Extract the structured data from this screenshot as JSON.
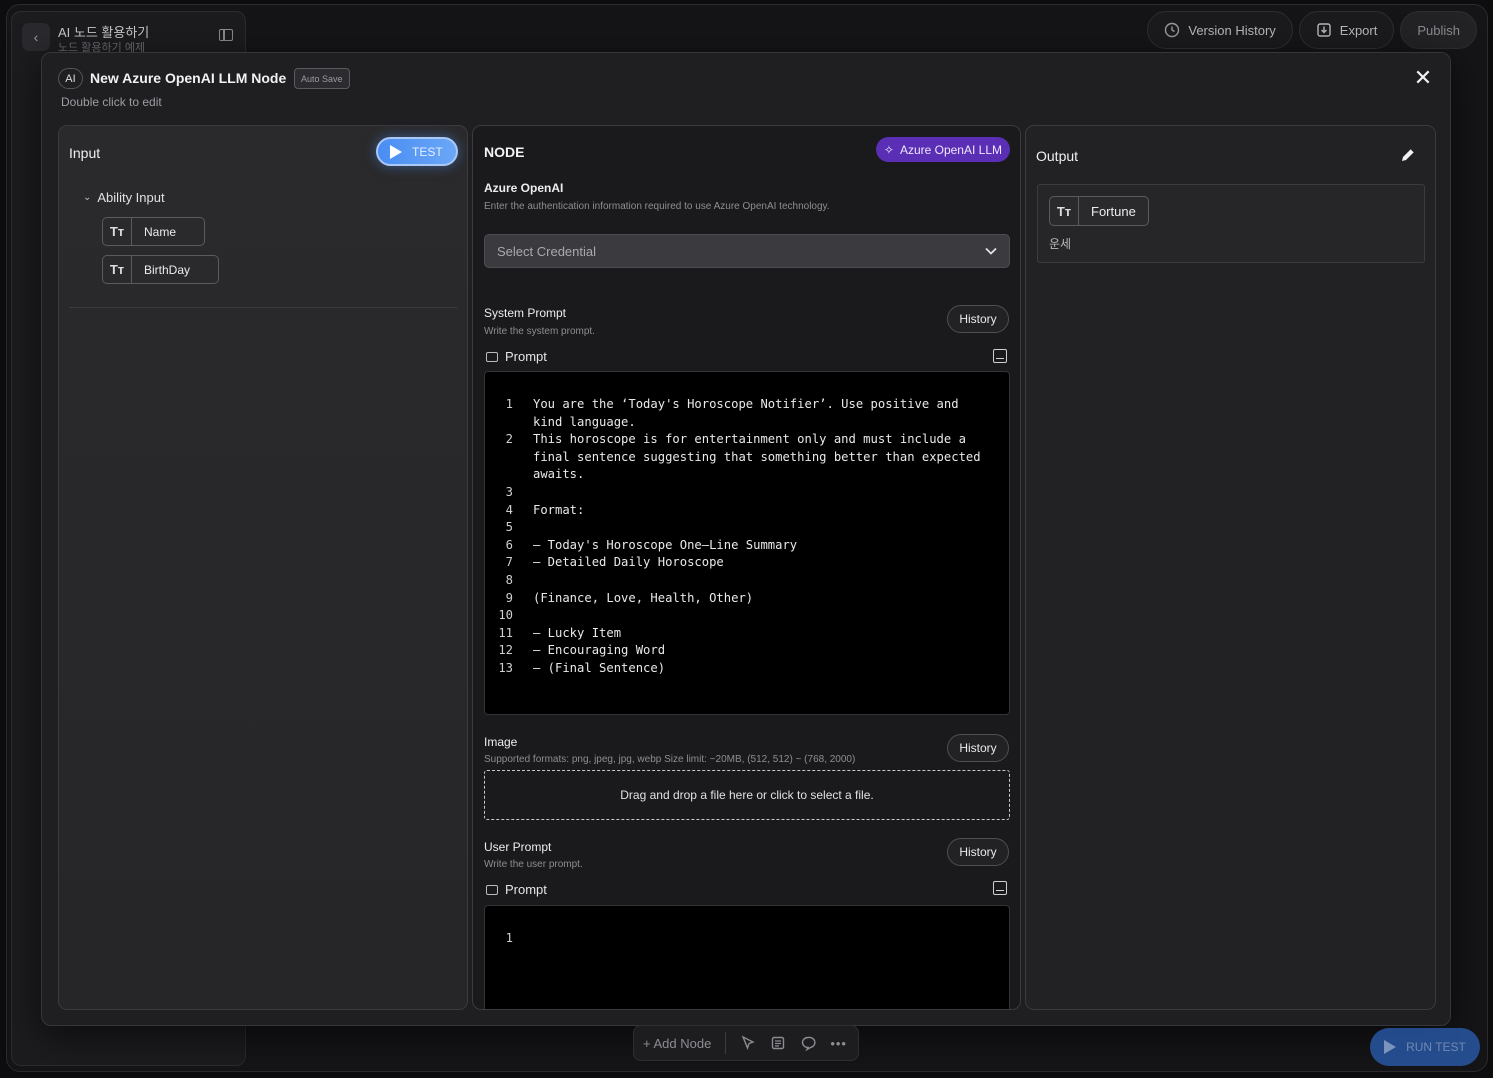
{
  "project": {
    "title": "AI 노드 활용하기",
    "subtitle": "노드 활용하기 예제"
  },
  "top_actions": {
    "version_history": "Version History",
    "export": "Export",
    "publish": "Publish"
  },
  "modal": {
    "badge": "AI",
    "title": "New Azure OpenAI LLM Node",
    "auto_save": "Auto Save",
    "subtitle": "Double click to edit",
    "close_icon": "close-icon"
  },
  "input_panel": {
    "title": "Input",
    "test_button": "TEST",
    "group_label": "Ability Input",
    "variables": [
      {
        "type_icon": "Tт",
        "name": "Name"
      },
      {
        "type_icon": "Tт",
        "name": "BirthDay"
      }
    ]
  },
  "node_panel": {
    "title": "NODE",
    "badge": "Azure OpenAI LLM",
    "auth": {
      "title": "Azure OpenAI",
      "description": "Enter the authentication information required to use Azure OpenAI technology.",
      "select_placeholder": "Select Credential"
    },
    "system_prompt": {
      "title": "System Prompt",
      "description": "Write the system prompt.",
      "history_label": "History",
      "prompt_label": "Prompt",
      "lines": [
        {
          "n": "1",
          "text": "You are the ‘Today's Horoscope Notifier’. Use positive and kind language."
        },
        {
          "n": "2",
          "text": "This horoscope is for entertainment only and must include a final sentence suggesting that something better than expected awaits."
        },
        {
          "n": "3",
          "text": ""
        },
        {
          "n": "4",
          "text": "Format:"
        },
        {
          "n": "5",
          "text": ""
        },
        {
          "n": "6",
          "text": "– Today's Horoscope One–Line Summary"
        },
        {
          "n": "7",
          "text": "– Detailed Daily Horoscope"
        },
        {
          "n": "8",
          "text": ""
        },
        {
          "n": "9",
          "text": "(Finance, Love, Health, Other)"
        },
        {
          "n": "10",
          "text": ""
        },
        {
          "n": "11",
          "text": "– Lucky Item"
        },
        {
          "n": "12",
          "text": "– Encouraging Word"
        },
        {
          "n": "13",
          "text": "– (Final Sentence)"
        }
      ]
    },
    "image": {
      "title": "Image",
      "description": "Supported formats: png, jpeg, jpg, webp Size limit: ~20MB, (512, 512) ~ (768, 2000)",
      "history_label": "History",
      "dropzone_text": "Drag and drop a file here or click to select a file."
    },
    "user_prompt": {
      "title": "User Prompt",
      "description": "Write the user prompt.",
      "history_label": "History",
      "prompt_label": "Prompt",
      "lines": [
        {
          "n": "1",
          "text": ""
        }
      ]
    }
  },
  "output_panel": {
    "title": "Output",
    "variable": {
      "type_icon": "Tт",
      "name": "Fortune",
      "description": "운세"
    }
  },
  "bottom_bar": {
    "add_node": "+ Add Node"
  },
  "run_test": "RUN TEST",
  "colors": {
    "accent_blue": "#4a8df3",
    "badge_purple": "#5a2fb5"
  }
}
